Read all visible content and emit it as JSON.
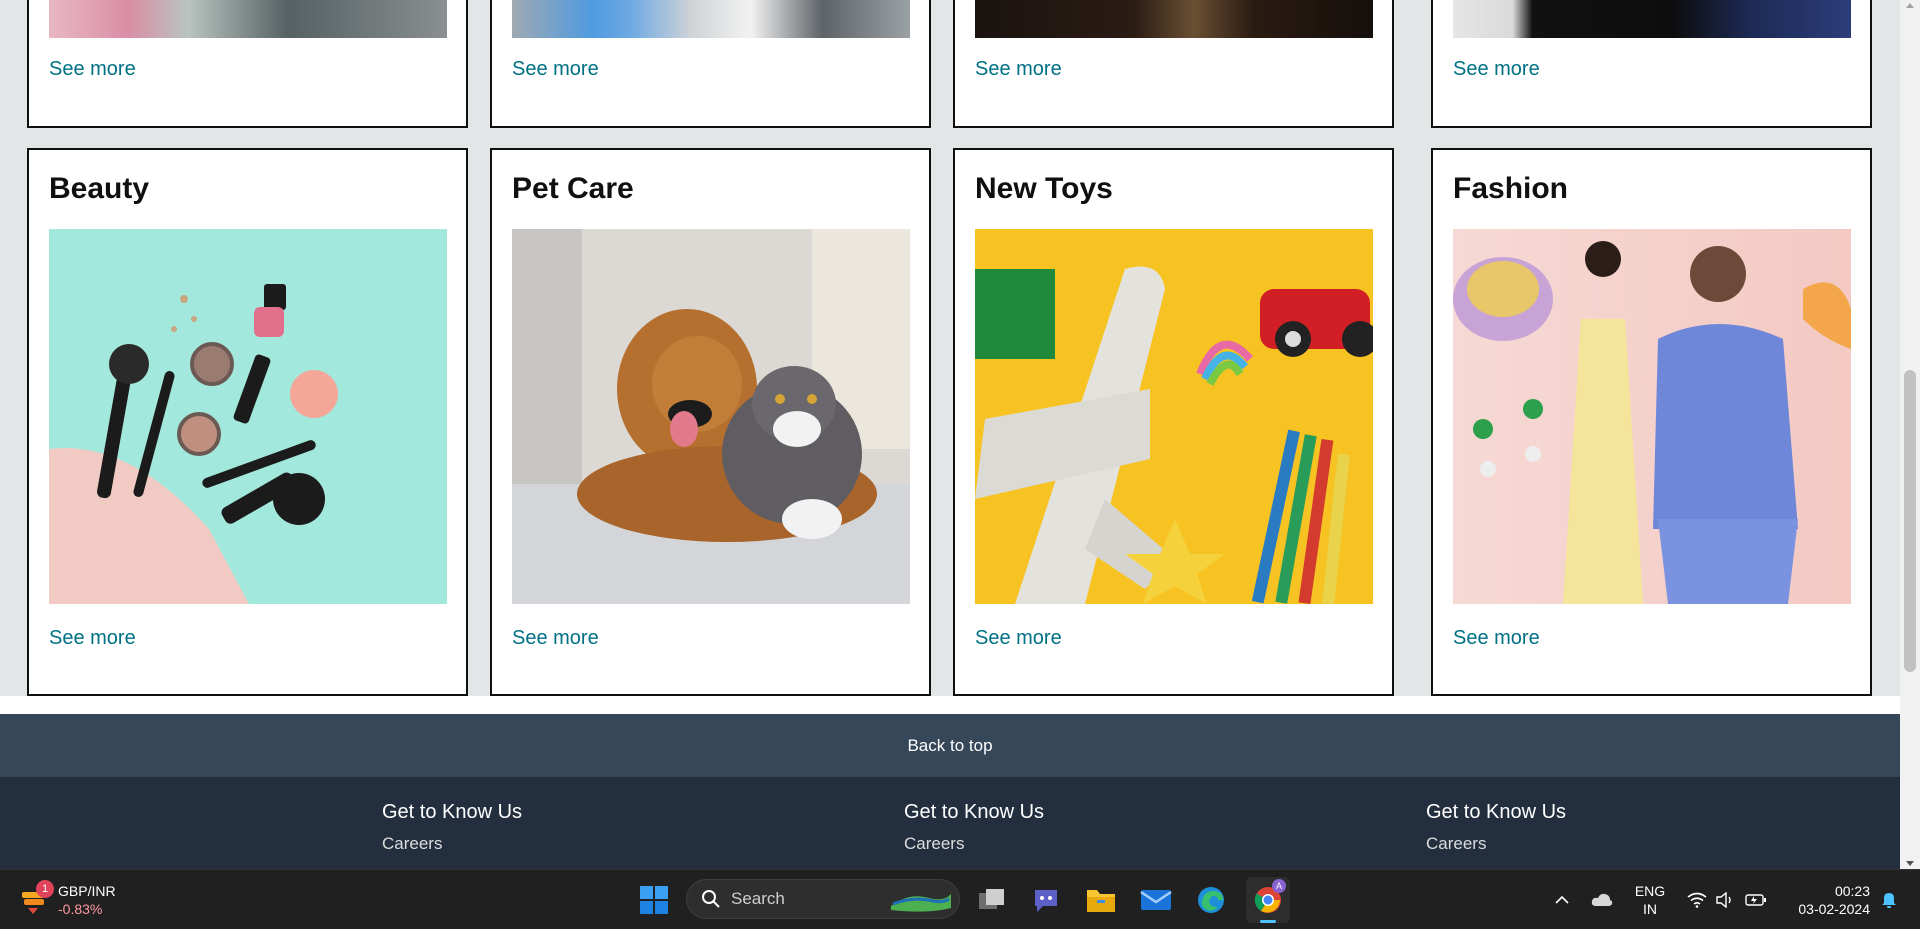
{
  "top_row": {
    "links": [
      "See more",
      "See more",
      "See more",
      "See more"
    ]
  },
  "cards": [
    {
      "title": "Beauty",
      "link": "See more",
      "image": "beauty-products-photo"
    },
    {
      "title": "Pet Care",
      "link": "See more",
      "image": "dog-and-cat-photo"
    },
    {
      "title": "New Toys",
      "link": "See more",
      "image": "toy-airplane-photo"
    },
    {
      "title": "Fashion",
      "link": "See more",
      "image": "fashion-models-photo"
    }
  ],
  "back_to_top": "Back to top",
  "footer": {
    "columns": [
      {
        "heading": "Get to Know Us",
        "link": "Careers"
      },
      {
        "heading": "Get to Know Us",
        "link": "Careers"
      },
      {
        "heading": "Get to Know Us",
        "link": "Careers"
      }
    ]
  },
  "taskbar": {
    "widget": {
      "title": "GBP/INR",
      "change": "-0.83%",
      "badge": "1"
    },
    "search_label": "Search",
    "language": {
      "line1": "ENG",
      "line2": "IN"
    },
    "time": "00:23",
    "date": "03-02-2024",
    "colors": {
      "change": "#ff99a4",
      "accent": "#0078d4"
    }
  }
}
